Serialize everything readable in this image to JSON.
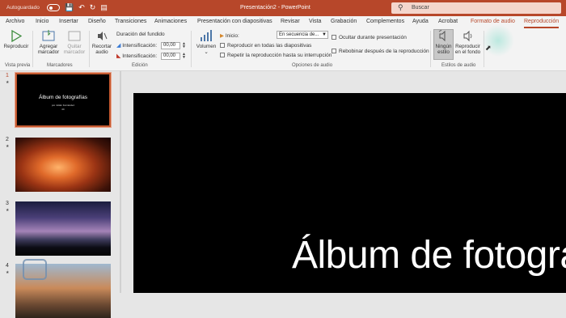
{
  "titlebar": {
    "autosave_label": "Autoguardado",
    "doc_title": "Presentación2 - PowerPoint",
    "search_placeholder": "Buscar"
  },
  "tabs": [
    {
      "label": "Archivo"
    },
    {
      "label": "Inicio"
    },
    {
      "label": "Insertar"
    },
    {
      "label": "Diseño"
    },
    {
      "label": "Transiciones"
    },
    {
      "label": "Animaciones"
    },
    {
      "label": "Presentación con diapositivas"
    },
    {
      "label": "Revisar"
    },
    {
      "label": "Vista"
    },
    {
      "label": "Grabación"
    },
    {
      "label": "Complementos"
    },
    {
      "label": "Ayuda"
    },
    {
      "label": "Acrobat"
    },
    {
      "label": "Formato de audio"
    },
    {
      "label": "Reproducción"
    }
  ],
  "ribbon": {
    "preview": {
      "play_label": "Reproducir",
      "group": "Vista previa"
    },
    "bookmarks": {
      "add_label": "Agregar marcador",
      "add_line1": "Agregar",
      "add_line2": "marcador",
      "remove_line1": "Quitar",
      "remove_line2": "marcador",
      "group": "Marcadores"
    },
    "editing": {
      "trim_line1": "Recortar",
      "trim_line2": "audio",
      "fade_title": "Duración del fundido",
      "fade_in_label": "Intensificación:",
      "fade_in_value": "00,00",
      "fade_out_label": "Intensificación:",
      "fade_out_value": "00,00",
      "group": "Edición"
    },
    "options": {
      "volume_label": "Volumen",
      "start_label": "Inicio:",
      "start_value": "En secuencia de...",
      "play_across": "Reproducir en todas las diapositivas",
      "loop": "Repetir la reproducción hasta su interrupción",
      "hide": "Ocultar durante presentación",
      "rewind": "Rebobinar después de la reproducción",
      "group": "Opciones de audio"
    },
    "styles": {
      "none_line1": "Ningún",
      "none_line2": "estilo",
      "bg_line1": "Reproducir",
      "bg_line2": "en el fondo",
      "group": "Estilos de audio"
    }
  },
  "slides": [
    {
      "number": "1",
      "title": "Álbum de fotografías",
      "subtitle": "por Julián Fernández",
      "extra": "4C"
    },
    {
      "number": "2"
    },
    {
      "number": "3"
    },
    {
      "number": "4"
    }
  ],
  "main_slide": {
    "title": "Álbum de fotogra"
  },
  "colors": {
    "accent": "#b7472a",
    "ribbon_bg": "#f3f3f3"
  }
}
